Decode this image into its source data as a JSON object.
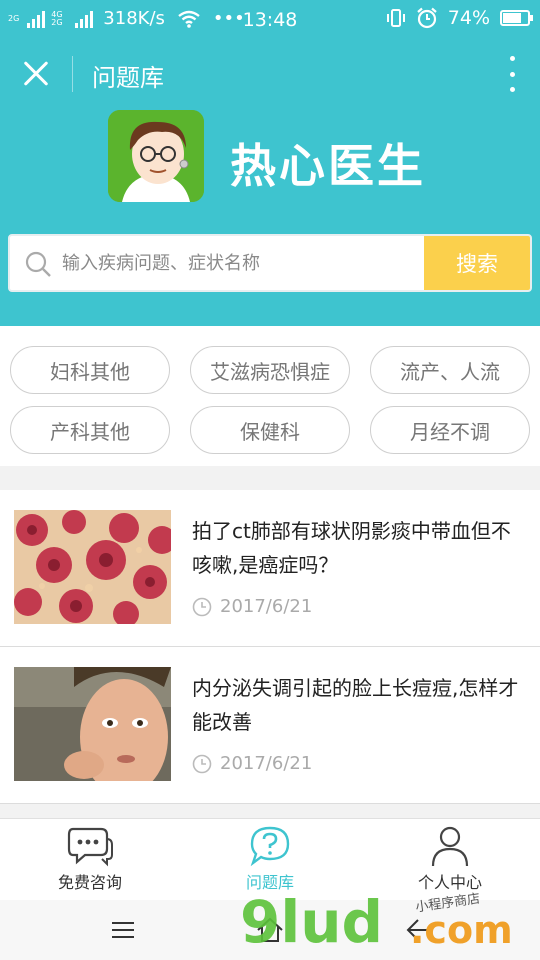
{
  "status_bar": {
    "net_tag_1": "2G",
    "net_tag_2": "4G 2G",
    "speed": "318K/s",
    "more": "•••",
    "time": "13:48",
    "battery": "74%",
    "battery_level": 0.74
  },
  "app_bar": {
    "title": "问题库"
  },
  "brand": {
    "name": "热心医生",
    "logo_color": "#5bb42d"
  },
  "search": {
    "placeholder": "输入疾病问题、症状名称",
    "button_label": "搜索"
  },
  "tags": [
    "妇科其他",
    "艾滋病恐惧症",
    "流产、人流",
    "产科其他",
    "保健科",
    "月经不调"
  ],
  "articles": [
    {
      "title": "拍了ct肺部有球状阴影痰中带血但不咳嗽,是癌症吗？",
      "date": "2017/6/21",
      "thumb": "bacteria-image"
    },
    {
      "title": "内分泌失调引起的脸上长痘痘,怎样才能改善",
      "date": "2017/6/21",
      "thumb": "woman-acne-image"
    }
  ],
  "bottom_nav": {
    "items": [
      {
        "label": "免费咨询",
        "icon": "chat-bubble-icon"
      },
      {
        "label": "问题库",
        "icon": "question-bubble-icon",
        "active": true
      },
      {
        "label": "个人中心",
        "icon": "person-icon"
      }
    ]
  },
  "watermark": {
    "main": "9lud",
    "suffix": ".com",
    "sub": "小程序商店"
  },
  "colors": {
    "primary": "#3ec4cf",
    "search_button": "#fbd04c",
    "active_nav": "#3ec4cf"
  }
}
